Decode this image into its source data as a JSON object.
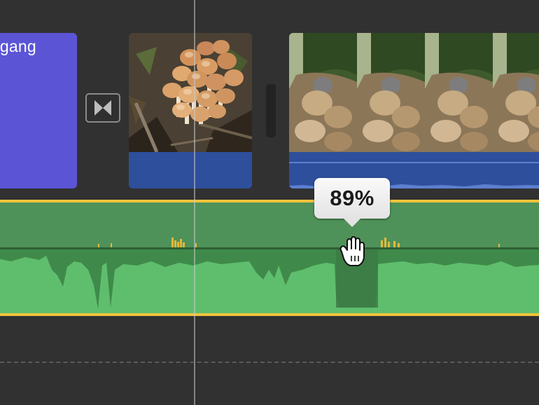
{
  "title_clip": {
    "text": "rgang"
  },
  "volume_tooltip": {
    "value": "89%"
  },
  "music_track": {
    "volume_percent": 89
  },
  "icons": {
    "transition": "transition-icon",
    "cursor": "hand-grab-cursor-icon"
  },
  "colors": {
    "background": "#313131",
    "title_clip": "#5b55d6",
    "clip_audio": "#2e4f9b",
    "music_track": "#4f9259",
    "track_border": "#f0c33c"
  }
}
